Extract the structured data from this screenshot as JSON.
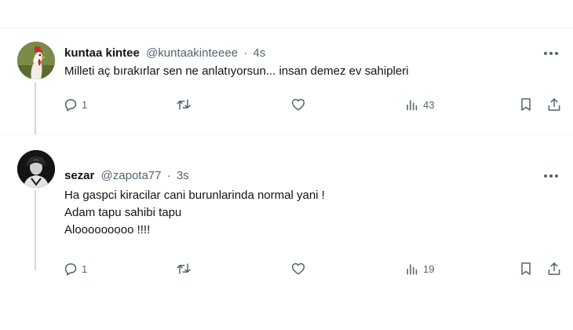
{
  "colors": {
    "text_primary": "#0f1419",
    "text_secondary": "#536471",
    "thread_line": "#cfd9de",
    "divider": "#eff3f4"
  },
  "tweets": [
    {
      "avatar_icon": "rooster-avatar",
      "display_name": "kuntaa kintee",
      "handle": "@kuntaakinteeee",
      "separator": "·",
      "timestamp": "4s",
      "text_lines": [
        "Milleti aç bırakırlar sen ne anlatıyorsun... insan demez ev sahipleri"
      ],
      "reply_count": "1",
      "view_count": "43"
    },
    {
      "avatar_icon": "person-avatar",
      "display_name": "sezar",
      "handle": "@zapota77",
      "separator": "·",
      "timestamp": "3s",
      "text_lines": [
        "Ha gaspci kiracilar cani burunlarinda normal yani !",
        "Adam tapu sahibi tapu",
        "Alooooooooo !!!!"
      ],
      "reply_count": "1",
      "view_count": "19"
    }
  ]
}
